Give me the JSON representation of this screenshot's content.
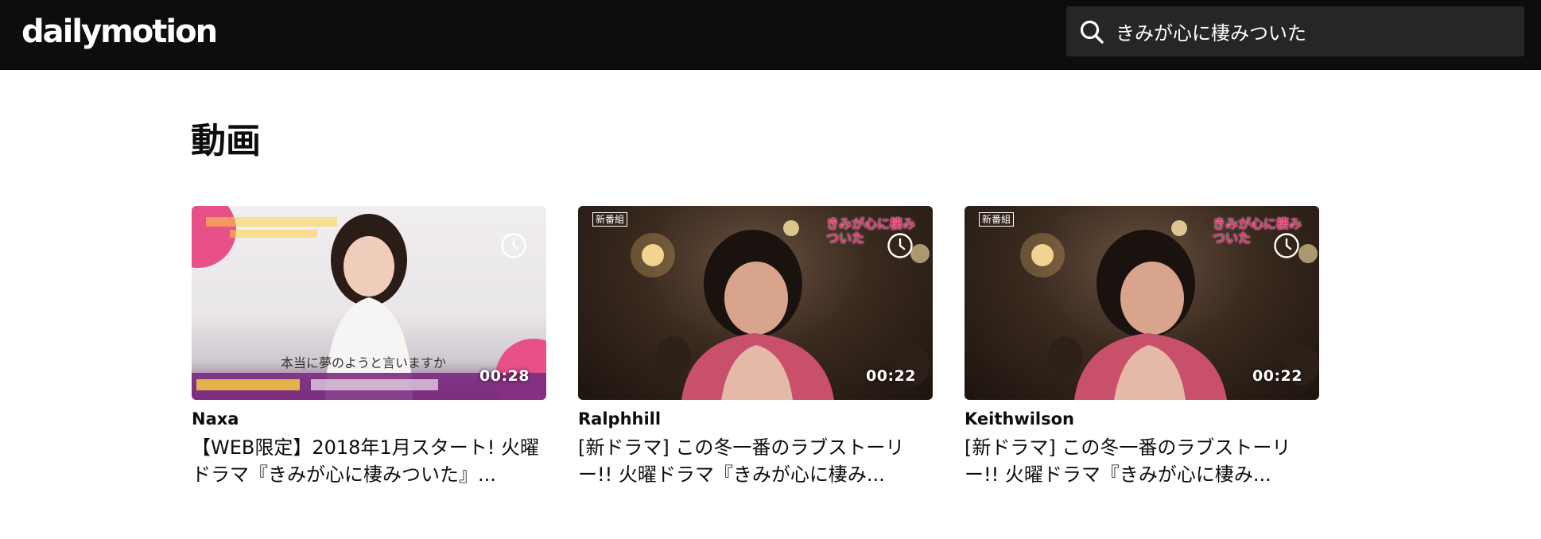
{
  "header": {
    "logo": "dailymotion",
    "search": {
      "value": "きみが心に棲みついた",
      "placeholder": ""
    }
  },
  "section": {
    "title": "動画"
  },
  "videos": [
    {
      "channel": "Naxa",
      "title": "【WEB限定】2018年1月スタート! 火曜ドラマ『きみが心に棲みついた』...",
      "duration": "00:28",
      "thumb_caption": "本当に夢のようと言いますか"
    },
    {
      "channel": "Ralphhill",
      "title": "[新ドラマ] この冬一番のラブストーリー!! 火曜ドラマ『きみが心に棲み...",
      "duration": "00:22",
      "thumb_badge": "新番組",
      "thumb_logo": "きみが心に棲みついた"
    },
    {
      "channel": "Keithwilson",
      "title": "[新ドラマ] この冬一番のラブストーリー!! 火曜ドラマ『きみが心に棲み...",
      "duration": "00:22",
      "thumb_badge": "新番組",
      "thumb_logo": "きみが心に棲みついた"
    }
  ],
  "colors": {
    "header_bg": "#0d0d0d",
    "search_bg": "#262626",
    "text": "#0d0d0d",
    "overlay_pink": "#e0306f"
  },
  "icons": {
    "search": "search-icon",
    "watch_later": "clock-icon"
  }
}
